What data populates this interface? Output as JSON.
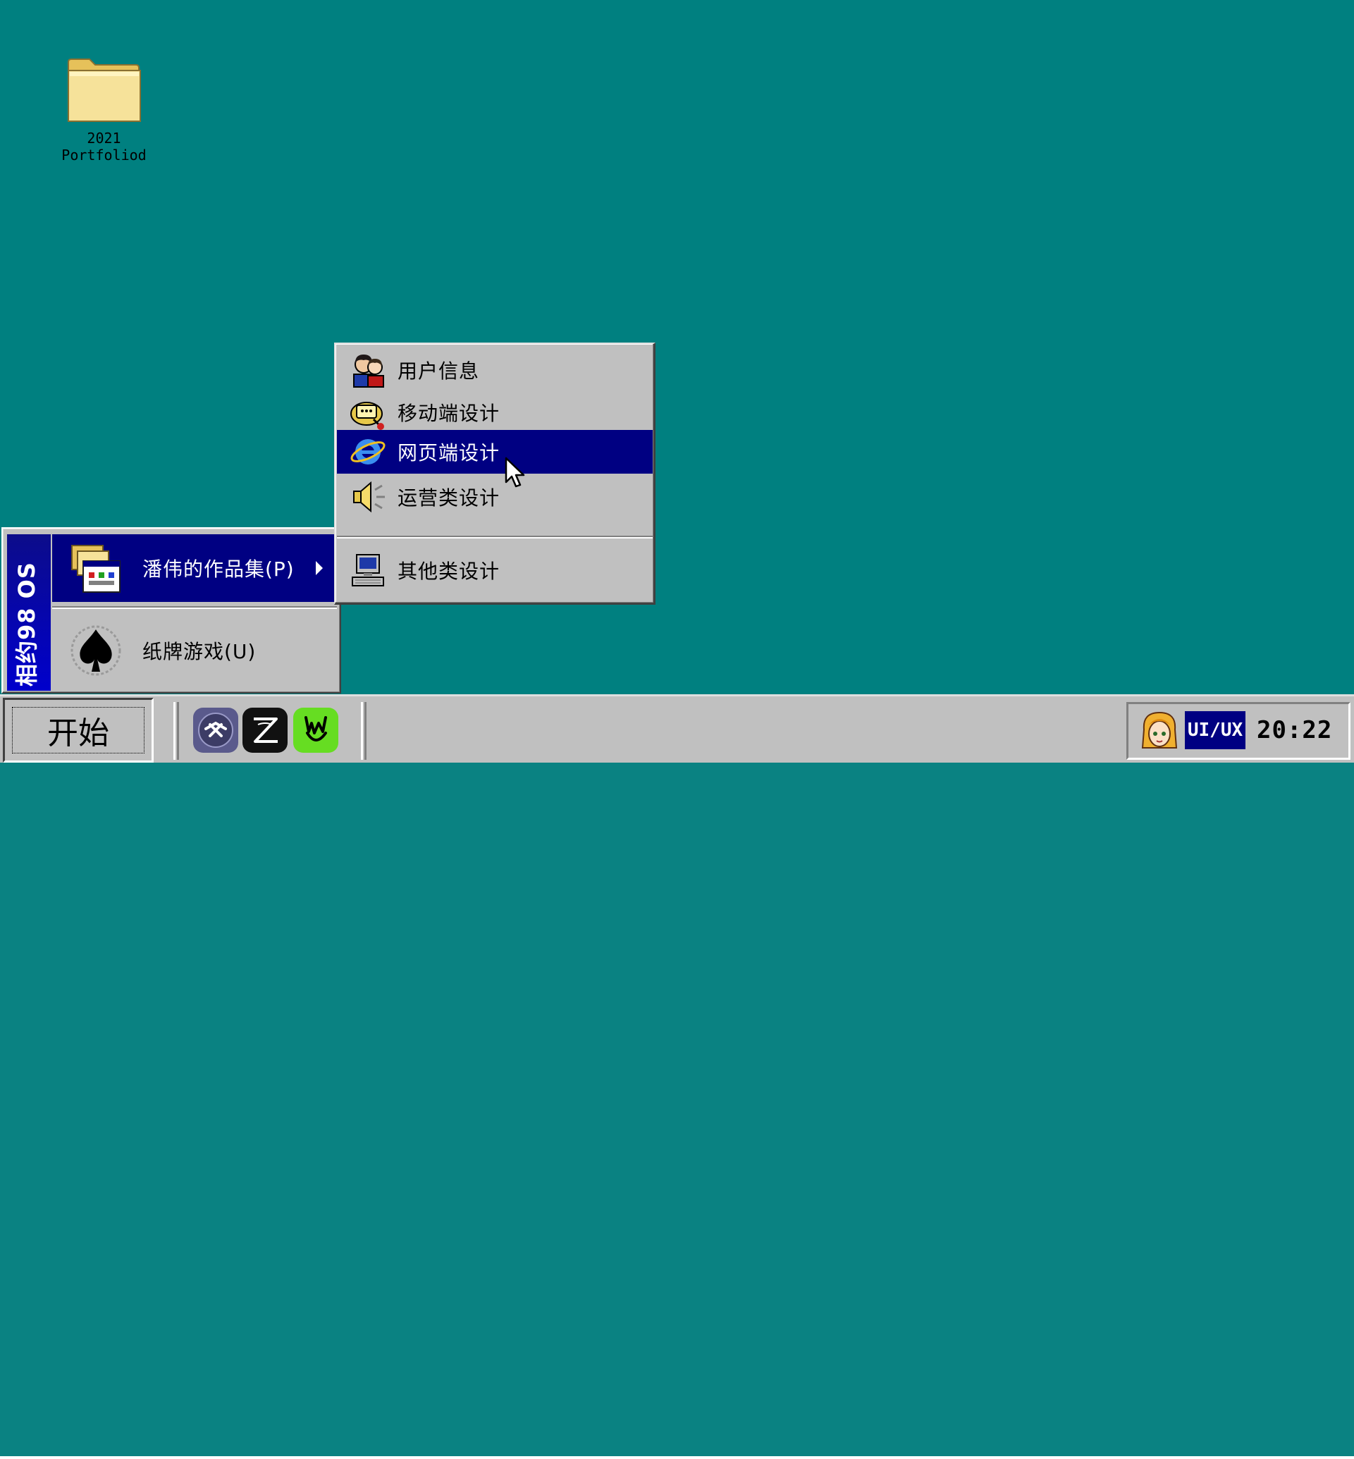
{
  "desktop": {
    "background_color": "#008080",
    "icons": [
      {
        "label": "2021\nPortfoliod",
        "icon": "folder-icon"
      }
    ]
  },
  "start_menu": {
    "banner_text": "相约98 OS",
    "items": [
      {
        "label": "潘伟的作品集(P)",
        "icon": "programs-folder-icon",
        "has_submenu": true,
        "selected": true
      },
      {
        "label": "纸牌游戏(U)",
        "icon": "spade-card-icon",
        "has_submenu": false,
        "selected": false
      }
    ]
  },
  "submenu": {
    "items": [
      {
        "label": "用户信息",
        "icon": "users-icon",
        "active": false
      },
      {
        "label": "移动端设计",
        "icon": "phone-icon",
        "active": false
      },
      {
        "label": "网页端设计",
        "icon": "internet-explorer-icon",
        "active": true
      },
      {
        "label": "运营类设计",
        "icon": "speaker-icon",
        "active": false
      },
      {
        "label": "其他类设计",
        "icon": "computer-icon",
        "active": false
      }
    ]
  },
  "taskbar": {
    "start_label": "开始",
    "quick_launch": [
      {
        "icon": "app-logo-icon",
        "color": "#5a5a8c"
      },
      {
        "icon": "zeplin-style-z-icon",
        "color": "#111111"
      },
      {
        "icon": "rock-hand-icon",
        "color": "#66dd22"
      }
    ],
    "tray": {
      "avatar_icon": "anime-avatar-icon",
      "badge": "UI/UX",
      "clock": "20:22"
    }
  },
  "colors": {
    "desktop": "#008080",
    "highlight": "#000082",
    "face": "#c0c0c0"
  }
}
